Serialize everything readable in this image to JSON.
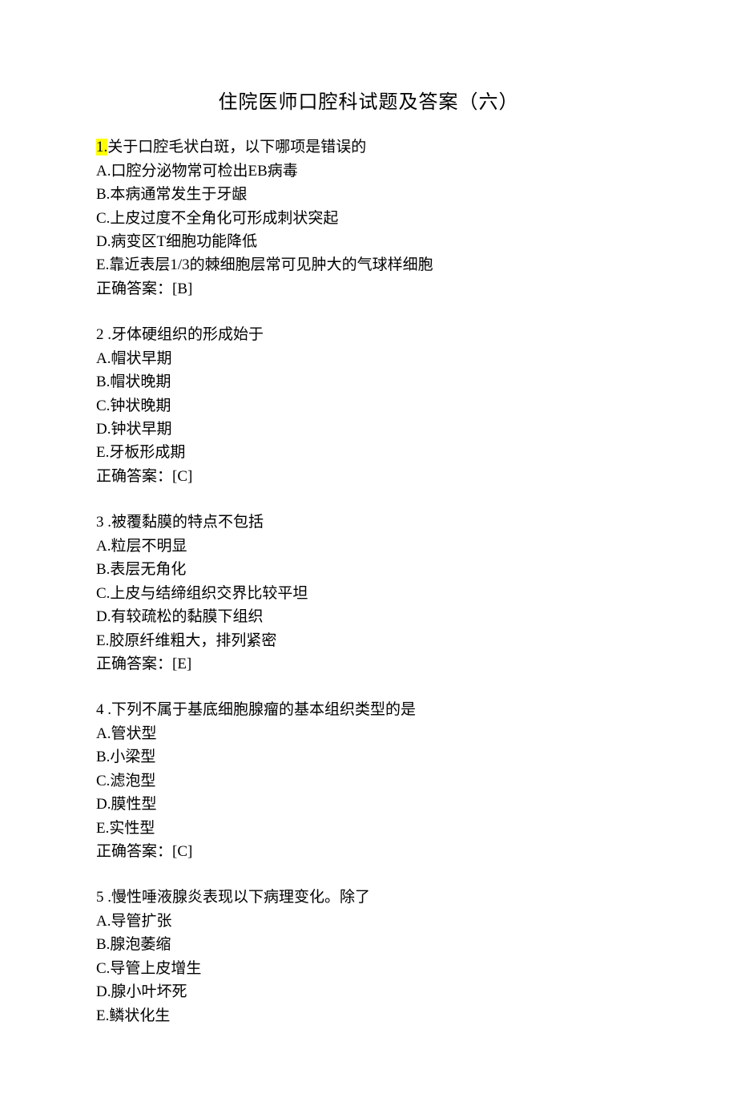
{
  "title": "住院医师口腔科试题及答案（六）",
  "questions": [
    {
      "num": "1.",
      "highlight": true,
      "stem": "关于口腔毛状白斑，以下哪项是错误的",
      "options": [
        "A.口腔分泌物常可检出EB病毒",
        "B.本病通常发生于牙龈",
        "C.上皮过度不全角化可形成刺状突起",
        "D.病变区T细胞功能降低",
        "E.靠近表层1/3的棘细胞层常可见肿大的气球样细胞"
      ],
      "answer": "正确答案：[B]"
    },
    {
      "num": "2 .",
      "highlight": false,
      "stem": "牙体硬组织的形成始于",
      "options": [
        "A.帽状早期",
        "B.帽状晚期",
        "C.钟状晚期",
        "D.钟状早期",
        "E.牙板形成期"
      ],
      "answer": "正确答案：[C]"
    },
    {
      "num": "3 .",
      "highlight": false,
      "stem": "被覆黏膜的特点不包括",
      "options": [
        "A.粒层不明显",
        "B.表层无角化",
        "C.上皮与结缔组织交界比较平坦",
        "D.有较疏松的黏膜下组织",
        "E.胶原纤维粗大，排列紧密"
      ],
      "answer": "正确答案：[E]"
    },
    {
      "num": "4 .",
      "highlight": false,
      "stem": "下列不属于基底细胞腺瘤的基本组织类型的是",
      "options": [
        "A.管状型",
        "B.小梁型",
        "C.滤泡型",
        "D.膜性型",
        "E.实性型"
      ],
      "answer": "正确答案：[C]"
    },
    {
      "num": "5 .",
      "highlight": false,
      "stem": "慢性唾液腺炎表现以下病理变化。除了",
      "options": [
        "A.导管扩张",
        "B.腺泡萎缩",
        "C.导管上皮增生",
        "D.腺小叶坏死",
        "E.鳞状化生"
      ],
      "answer": ""
    }
  ]
}
